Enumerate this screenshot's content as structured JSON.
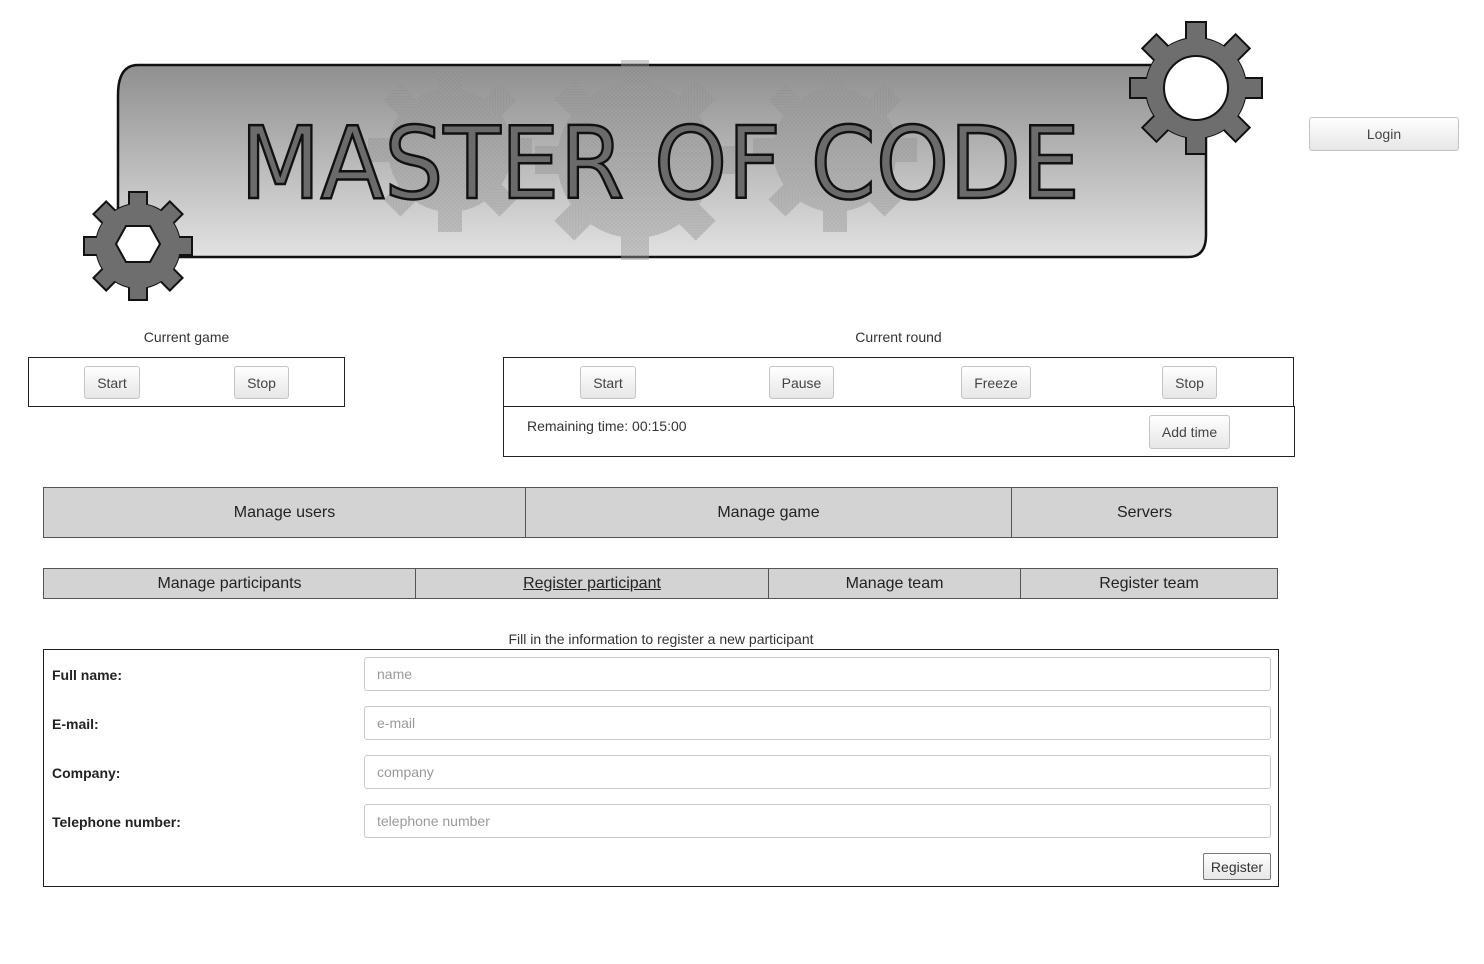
{
  "banner": {
    "title": "MASTER OF CODE"
  },
  "header": {
    "login_label": "Login"
  },
  "current_game": {
    "title": "Current game",
    "start_label": "Start",
    "stop_label": "Stop"
  },
  "current_round": {
    "title": "Current round",
    "start_label": "Start",
    "pause_label": "Pause",
    "freeze_label": "Freeze",
    "stop_label": "Stop",
    "remaining_time": "Remaining time: 00:15:00",
    "add_time_label": "Add time"
  },
  "main_nav": {
    "items": [
      "Manage users",
      "Manage game",
      "Servers"
    ]
  },
  "sub_nav": {
    "items": [
      "Manage participants",
      "Register participant",
      "Manage team",
      "Register team"
    ],
    "active_index": 1
  },
  "form": {
    "caption": "Fill in the information to register a new participant",
    "fields": [
      {
        "label": "Full name:",
        "placeholder": "name",
        "value": ""
      },
      {
        "label": "E-mail:",
        "placeholder": "e-mail",
        "value": ""
      },
      {
        "label": "Company:",
        "placeholder": "company",
        "value": ""
      },
      {
        "label": "Telephone number:",
        "placeholder": "telephone number",
        "value": ""
      }
    ],
    "register_label": "Register"
  },
  "colors": {
    "nav_bg": "#d3d3d3",
    "gear": "#6e6e6e",
    "title_fill": "#6b6b6b"
  }
}
